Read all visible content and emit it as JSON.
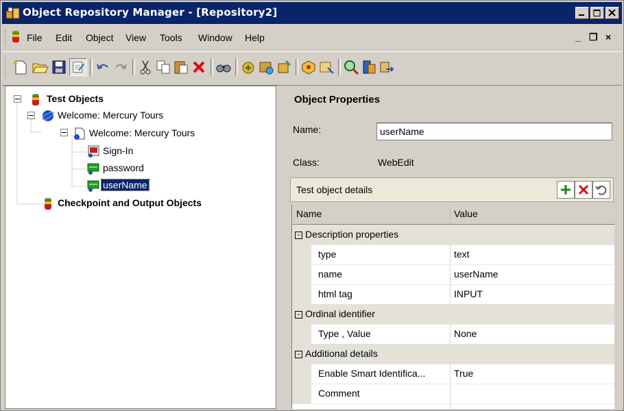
{
  "window": {
    "title": "Object Repository Manager - [Repository2]"
  },
  "menu": {
    "items": [
      "File",
      "Edit",
      "Object",
      "View",
      "Tools",
      "Window",
      "Help"
    ]
  },
  "tree": {
    "root": "Test Objects",
    "browser": "Welcome: Mercury Tours",
    "page": "Welcome: Mercury Tours",
    "children": [
      "Sign-In",
      "password",
      "userName"
    ],
    "checkpoints": "Checkpoint and Output Objects"
  },
  "properties": {
    "title": "Object Properties",
    "name_label": "Name:",
    "name_value": "userName",
    "class_label": "Class:",
    "class_value": "WebEdit",
    "details_title": "Test object details",
    "columns": [
      "Name",
      "Value"
    ],
    "rows": [
      {
        "name": "Description properties",
        "value": ""
      },
      {
        "name": "type",
        "value": "text"
      },
      {
        "name": "name",
        "value": "userName"
      },
      {
        "name": "html tag",
        "value": "INPUT"
      },
      {
        "name": "Ordinal identifier",
        "value": ""
      },
      {
        "name": "Type , Value",
        "value": "None"
      },
      {
        "name": "Additional details",
        "value": ""
      },
      {
        "name": "Enable Smart Identifica...",
        "value": "True"
      },
      {
        "name": "Comment",
        "value": ""
      }
    ]
  },
  "colors": {
    "title_bar": "#0a246a",
    "selection": "#0a246a",
    "add": "#1a8a1a",
    "remove": "#d01010"
  }
}
